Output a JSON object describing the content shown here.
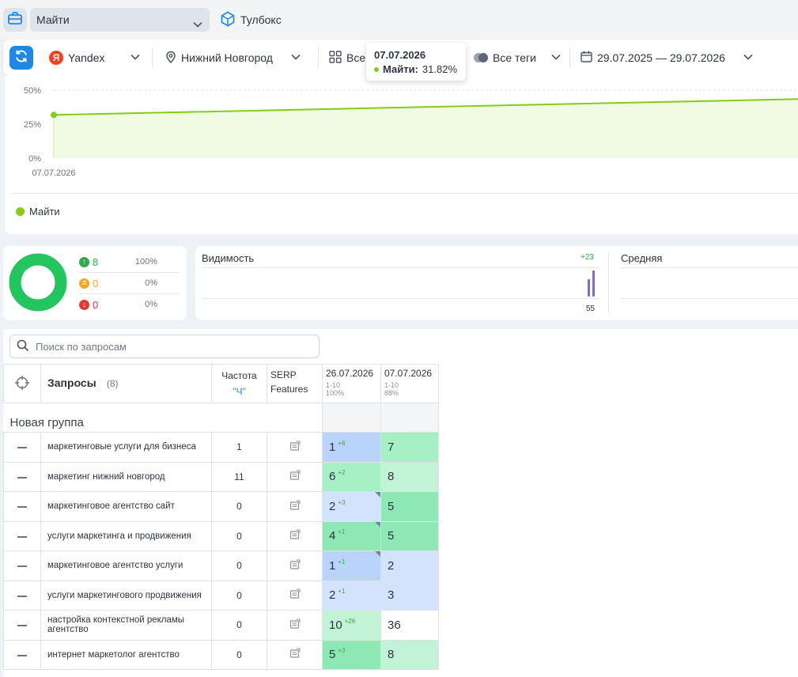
{
  "colors": {
    "accent": "#1e88e5",
    "series": "#84cc16",
    "series_fill": "#f1fae3",
    "up": "#2eaa4a",
    "neutral": "#f5a524",
    "down": "#e53935",
    "donut": "#22c55e",
    "vis_bar": "#8b5cf6",
    "cell_blue": "#b9d3fb",
    "cell_blue_light": "#d3e3fd",
    "cell_green": "#8ee8b4",
    "cell_green_mid": "#a7efc5",
    "cell_green_light": "#c3f3d6",
    "cell_white": "#ffffff"
  },
  "topbar": {
    "project": "Майти",
    "toolbox_label": "Тулбокс",
    "briefcase_icon": "briefcase-icon",
    "toolbox_icon": "cube-icon"
  },
  "filters": {
    "engine": "Yandex",
    "engine_badge": "Я",
    "region": "Нижний Новгород",
    "groups": "Все",
    "tags": "Все теги",
    "date_range": "29.07.2025 — 29.07.2026"
  },
  "tooltip": {
    "date": "07.07.2026",
    "series": "Майти:",
    "value": "31.82%"
  },
  "chart_data": {
    "type": "area",
    "x": [
      "07.07.2026"
    ],
    "series": [
      {
        "name": "Майти",
        "values": [
          31.82
        ]
      }
    ],
    "y_ticks": [
      "50%",
      "25%",
      "0%"
    ],
    "ylim": [
      0,
      50
    ],
    "x_tick_labels": [
      "07.07.2026"
    ],
    "grid": true,
    "legend_position": "bottom-left"
  },
  "stats": {
    "rows": [
      {
        "value": "8",
        "percent": "100%",
        "kind": "up"
      },
      {
        "value": "0",
        "percent": "0%",
        "kind": "neutral"
      },
      {
        "value": "0",
        "percent": "0%",
        "kind": "down"
      }
    ],
    "donut_fraction": 1.0
  },
  "visibility": {
    "title": "Видимость",
    "delta": "+23",
    "value": "55",
    "avg_title": "Средняя"
  },
  "table": {
    "search_placeholder": "Поиск по запросам",
    "header": {
      "queries": "Запросы",
      "count": "(8)",
      "freq_line1": "Частота",
      "freq_line2": "\"Ч\"",
      "serp_line1": "SERP",
      "serp_line2": "Features",
      "dates": [
        {
          "date": "26.07.2026",
          "range": "1-10",
          "pct": "100%"
        },
        {
          "date": "07.07.2026",
          "range": "1-10",
          "pct": "88%"
        }
      ]
    },
    "group_name": "Новая группа",
    "rows": [
      {
        "query": "маркетинговые услуги для бизнеса",
        "freq": "1",
        "p1": "1",
        "d1": "+6",
        "p2": "7",
        "bg1": "cell_blue",
        "bg2": "cell_green_mid",
        "corner": false
      },
      {
        "query": "маркетинг нижний новгород",
        "freq": "11",
        "p1": "6",
        "d1": "+2",
        "p2": "8",
        "bg1": "cell_green_mid",
        "bg2": "cell_green_light",
        "corner": false
      },
      {
        "query": "маркетинговое агентство сайт",
        "freq": "0",
        "p1": "2",
        "d1": "+3",
        "p2": "5",
        "bg1": "cell_blue_light",
        "bg2": "cell_green",
        "corner": true
      },
      {
        "query": "услуги маркетинга и продвижения",
        "freq": "0",
        "p1": "4",
        "d1": "+1",
        "p2": "5",
        "bg1": "cell_green",
        "bg2": "cell_green",
        "corner": true
      },
      {
        "query": "маркетинговое агентство услуги",
        "freq": "0",
        "p1": "1",
        "d1": "+1",
        "p2": "2",
        "bg1": "cell_blue",
        "bg2": "cell_blue_light",
        "corner": true
      },
      {
        "query": "услуги маркетингового продвижения",
        "freq": "0",
        "p1": "2",
        "d1": "+1",
        "p2": "3",
        "bg1": "cell_blue_light",
        "bg2": "cell_blue_light",
        "corner": false
      },
      {
        "query": "настройка контекстной рекламы агентство",
        "freq": "0",
        "p1": "10",
        "d1": "+26",
        "p2": "36",
        "bg1": "cell_green_light",
        "bg2": "cell_white",
        "corner": false
      },
      {
        "query": "интернет маркетолог агентство",
        "freq": "0",
        "p1": "5",
        "d1": "+3",
        "p2": "8",
        "bg1": "cell_green",
        "bg2": "cell_green_light",
        "corner": false
      }
    ]
  }
}
